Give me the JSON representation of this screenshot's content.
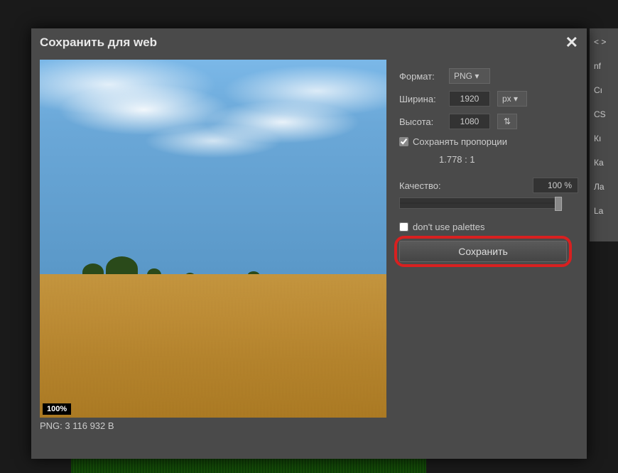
{
  "dialog": {
    "title": "Сохранить для web"
  },
  "preview": {
    "zoom": "100%",
    "file_info": "PNG: 3 116 932 B"
  },
  "controls": {
    "format": {
      "label": "Формат:",
      "value": "PNG ▾"
    },
    "width": {
      "label": "Ширина:",
      "value": "1920",
      "unit": "px ▾"
    },
    "height": {
      "label": "Высота:",
      "value": "1080",
      "swap": "⇅"
    },
    "keep_ratio": {
      "label": "Сохранять пропорции",
      "checked": true
    },
    "ratio": "1.778 : 1",
    "quality": {
      "label": "Качество:",
      "value": "100 %"
    },
    "palettes": {
      "label": "don't use palettes",
      "checked": false
    },
    "save_button": "Сохранить"
  },
  "bg_panel": {
    "items": [
      "< >",
      "nf",
      "Cı",
      "CS",
      "Кı",
      "Ка",
      "Ла",
      "La"
    ]
  }
}
